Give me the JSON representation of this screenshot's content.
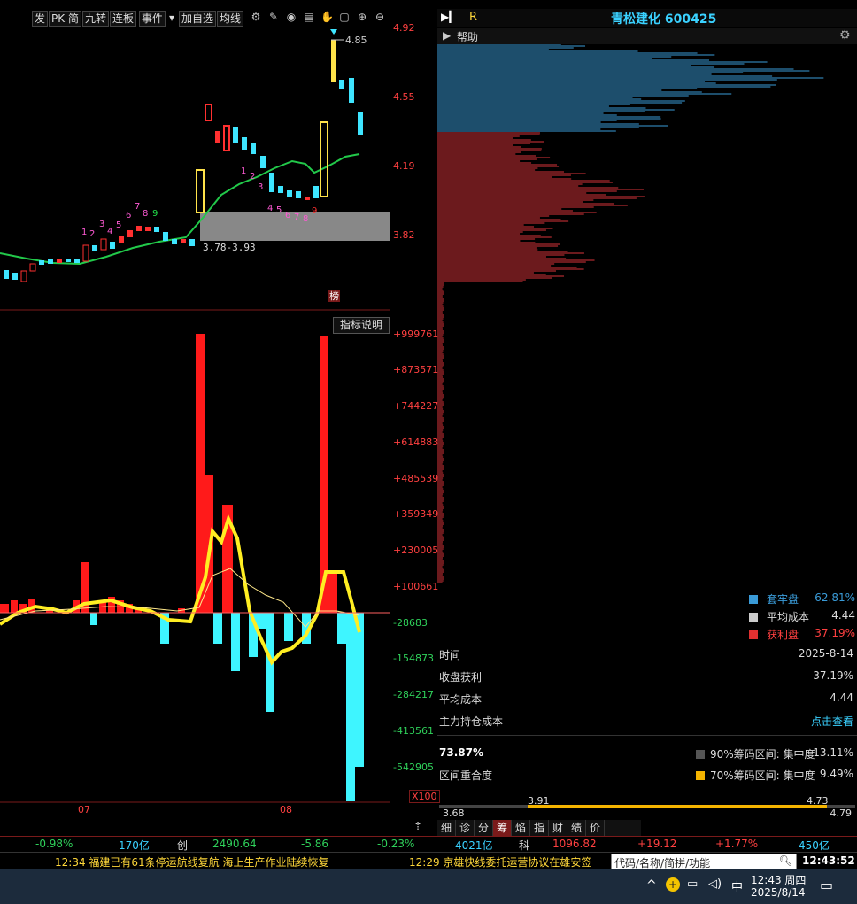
{
  "toolbar": {
    "items": [
      "发",
      "PK",
      "简",
      "九转",
      "连板",
      "事件",
      "▾",
      "加自选",
      "均线"
    ]
  },
  "price_axis": [
    "4.92",
    "4.55",
    "4.19",
    "3.82"
  ],
  "indicator_axis": [
    "+999761",
    "+873571",
    "+744227",
    "+614883",
    "+485539",
    "+359349",
    "+230005",
    "+100661",
    "-28683",
    "-154873",
    "-284217",
    "-413561",
    "-542905"
  ],
  "indicator_unit": "X100",
  "indicator_help": "指标说明",
  "rank_label": "榜",
  "candle_annotations": {
    "high_label": "4.85",
    "range_label": "3.78-3.93"
  },
  "time_labels": [
    "07",
    "08"
  ],
  "td_counts_a": [
    "1",
    "2",
    "3",
    "4",
    "5",
    "6",
    "7",
    "8",
    "9"
  ],
  "td_counts_b": [
    "1",
    "2",
    "3",
    "4",
    "5",
    "6",
    "7",
    "8",
    "9"
  ],
  "right_panel": {
    "title": "青松建化 600425",
    "r_label": "R",
    "help": "帮助",
    "legend": [
      {
        "label": "套牢盘",
        "value": "62.81%",
        "color": "#3a9bd8"
      },
      {
        "label": "平均成本",
        "value": "4.44",
        "color": "#cccccc"
      },
      {
        "label": "获利盘",
        "value": "37.19%",
        "color": "#e03030"
      }
    ],
    "rows": [
      {
        "label": "时间",
        "value": "2025-8-14"
      },
      {
        "label": "收盘获利",
        "value": "37.19%"
      },
      {
        "label": "平均成本",
        "value": "4.44"
      },
      {
        "label": "主力持仓成本",
        "value": "点击查看"
      }
    ],
    "overlap_pct": "73.87%",
    "overlap_label": "区间重合度",
    "ranges": [
      {
        "label": "90%筹码区间: 集中度",
        "value": "13.11%",
        "color": "#555555"
      },
      {
        "label": "70%筹码区间: 集中度",
        "value": "9.49%",
        "color": "#f4b400"
      }
    ],
    "scale": {
      "min": "3.68",
      "low": "3.91",
      "high": "4.73",
      "max": "4.79"
    },
    "tabs": [
      "细",
      "诊",
      "分",
      "筹",
      "焰",
      "指",
      "财",
      "绩",
      "价"
    ]
  },
  "ticker": [
    "-0.98%",
    "170亿",
    "创",
    "2490.64",
    "-5.86",
    "-0.23%",
    "4021亿",
    "科",
    "1096.82",
    "+19.12",
    "+1.77%",
    "450亿"
  ],
  "news": [
    "12:34 福建已有61条停运航线复航 海上生产作业陆续恢复",
    "12:29 京雄快线委托运营协议在雄安签"
  ],
  "search_placeholder": "代码/名称/简拼/功能",
  "clock": "12:43:52",
  "taskbar": {
    "time": "12:43 周四",
    "date": "2025/8/14",
    "ime": "中"
  }
}
